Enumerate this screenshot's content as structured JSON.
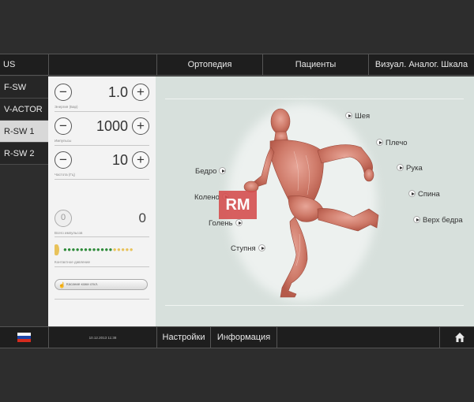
{
  "topnav": {
    "tab_us": "US",
    "tab_ortho": "Ортопедия",
    "tab_patients": "Пациенты",
    "tab_vas": "Визуал. Аналог. Шкала"
  },
  "leftmenu": {
    "items": [
      {
        "label": "F-SW"
      },
      {
        "label": "V-ACTOR"
      },
      {
        "label": "R-SW 1"
      },
      {
        "label": "R-SW 2"
      }
    ],
    "active_index": 2
  },
  "controls": {
    "energy": {
      "value": "1.0",
      "label": "Энергия (Бар)"
    },
    "pulses": {
      "value": "1000",
      "label": "Импульсы"
    },
    "frequency": {
      "value": "10",
      "label": "Частота (Гц)"
    },
    "total_pulses": {
      "value": "0",
      "label": "Всего импульсов"
    },
    "contact_pressure": {
      "label": "Контактное давление"
    },
    "skin_touch_button": "Касание кожи откл."
  },
  "body_parts": {
    "neck": "Шея",
    "shoulder": "Плечо",
    "arm": "Рука",
    "back": "Спина",
    "upper_thigh": "Верх бедра",
    "hip": "Бедро",
    "knee": "Колено",
    "shin": "Голень",
    "foot": "Ступня"
  },
  "logo_text": "RM",
  "bottombar": {
    "datetime": "10.12.2013 11:38",
    "settings": "Настройки",
    "info": "Информация"
  },
  "colors": {
    "panel_bg": "#f3f3f3",
    "body_bg": "#d7e0dc",
    "bar_bg": "#1e1e1e",
    "pressure_green": "#2e8b3a",
    "pressure_yellow": "#e8c25a",
    "logo_red": "#d55050"
  }
}
